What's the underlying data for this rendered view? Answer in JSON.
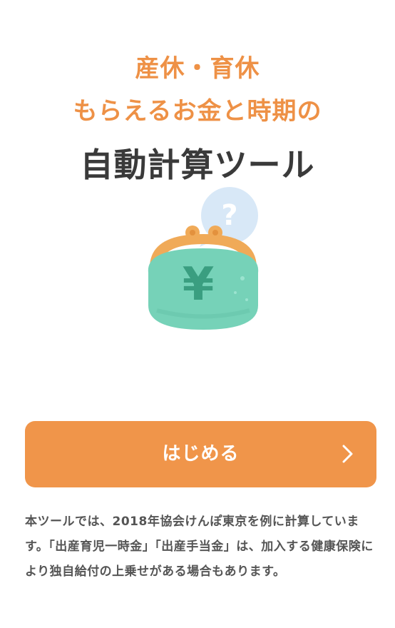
{
  "header": {
    "title_line1": "産休・育休",
    "title_line2": "もらえるお金と時期の",
    "title_line3": "自動計算ツール"
  },
  "illustration": {
    "icon": "coin-purse-yen-icon",
    "bubble_icon": "question-bubble-icon",
    "yen_symbol": "¥",
    "question_symbol": "?",
    "colors": {
      "purse": "#76d2b8",
      "clasp": "#f0aa58",
      "yen": "#3a9e80",
      "bubble": "#d8e8f7"
    }
  },
  "start_button": {
    "label": "はじめる",
    "icon": "chevron-right-icon",
    "color": "#f0954a"
  },
  "disclaimer": {
    "text": "本ツールでは、2018年協会けんぽ東京を例に計算しています。「出産育児一時金」「出産手当金」は、加入する健康保険により独自給付の上乗せがある場合もあります。"
  },
  "colors": {
    "accent": "#ee9146",
    "heading": "#3a3a3a",
    "body_text": "#555555",
    "background": "#ffffff"
  }
}
